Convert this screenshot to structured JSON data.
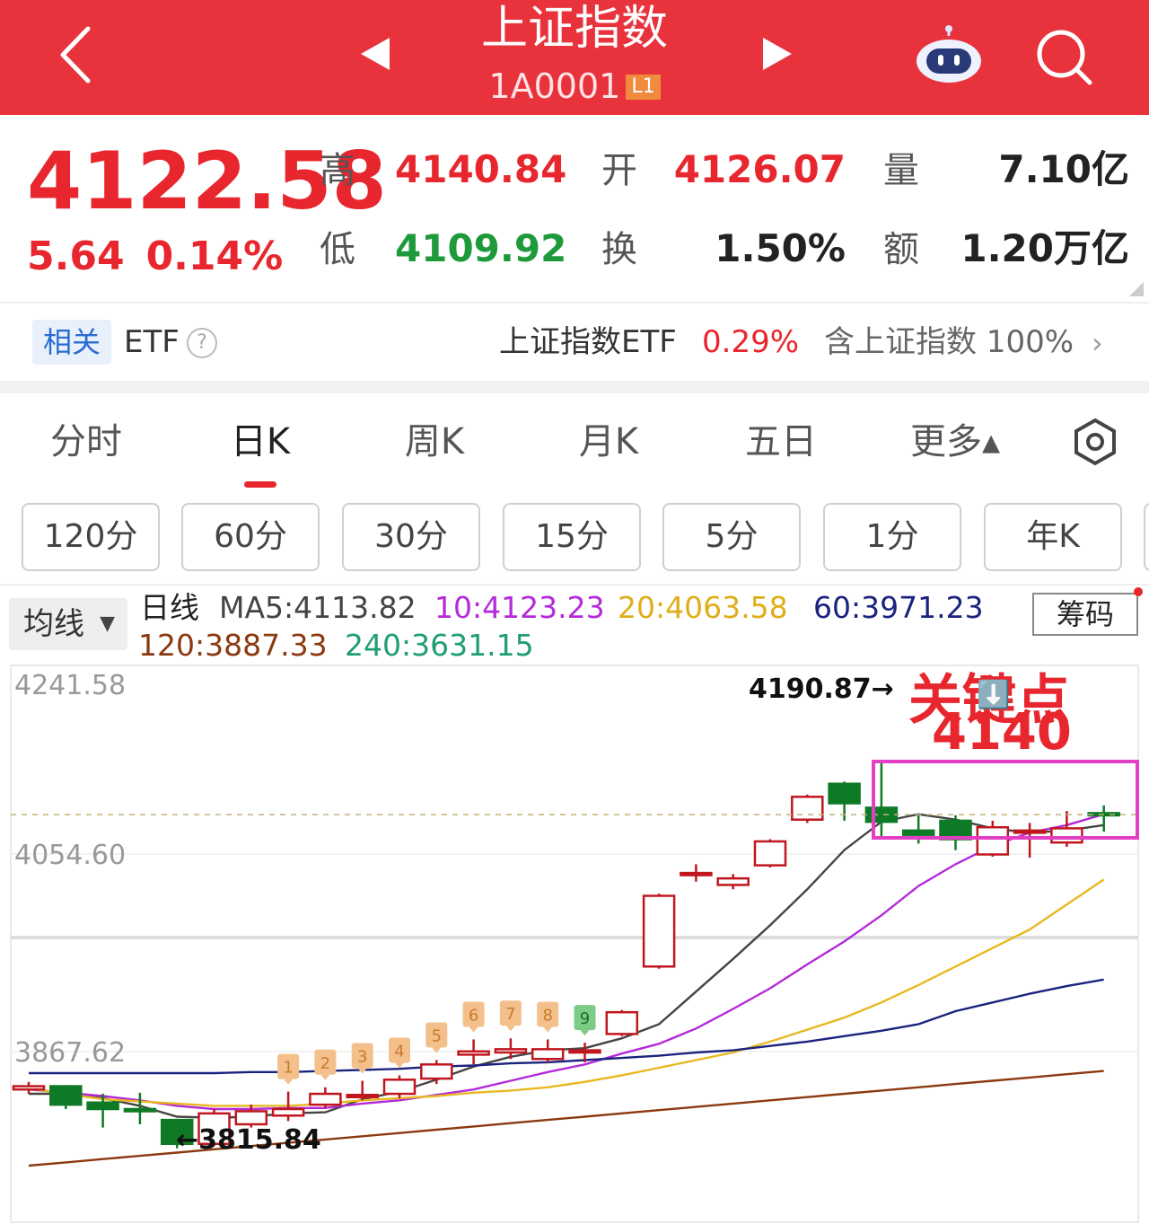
{
  "header": {
    "title": "上证指数",
    "code": "1A0001",
    "level_badge": "L1",
    "bg_color": "#e8323c"
  },
  "quote": {
    "price": "4122.58",
    "change": "5.64",
    "change_pct": "0.14%",
    "high_label": "高",
    "high": "4140.84",
    "low_label": "低",
    "low": "4109.92",
    "open_label": "开",
    "open": "4126.07",
    "turnover_label": "换",
    "turnover": "1.50%",
    "volume_label": "量",
    "volume": "7.10亿",
    "amount_label": "额",
    "amount": "1.20万亿"
  },
  "etf": {
    "tag": "相关",
    "label": "ETF",
    "help": "?",
    "name": "上证指数ETF",
    "pct": "0.29%",
    "include": "含上证指数 100%",
    "arrow": "›"
  },
  "tabs": [
    {
      "label": "分时"
    },
    {
      "label": "日K",
      "active": true
    },
    {
      "label": "周K"
    },
    {
      "label": "月K"
    },
    {
      "label": "五日"
    },
    {
      "label": "更多▴"
    }
  ],
  "periods": [
    "120分",
    "60分",
    "30分",
    "15分",
    "5分",
    "1分",
    "年K"
  ],
  "ma_legend": {
    "selector": "均线",
    "selector_caret": "▼",
    "period_label": "日线",
    "ma5": "MA5:4113.82",
    "ma10": "10:4123.23",
    "ma20": "20:4063.58",
    "ma60": "60:3971.23",
    "ma120": "120:3887.33",
    "ma240": "240:3631.15",
    "chip_button": "筹码",
    "colors": {
      "ma5": "#444444",
      "ma10": "#b42ad8",
      "ma20": "#e8b820",
      "ma60": "#1a237e",
      "ma120": "#8b3a10",
      "ma240": "#1f9e72"
    }
  },
  "chart_data": {
    "type": "candlestick",
    "y_ticks": [
      "4241.58",
      "4054.60",
      "3867.62"
    ],
    "ylim": [
      3800,
      4241.58
    ],
    "reference_price": 4122.58,
    "high_mark": "4190.87→",
    "low_mark": "←3815.84",
    "annotation_title": "关键点",
    "annotation_arrow": "⬇️",
    "annotation_value": "4140",
    "nine_labels": [
      "1",
      "2",
      "3",
      "4",
      "5",
      "6",
      "7",
      "8",
      "9"
    ],
    "candles": [
      {
        "o": 3870,
        "c": 3873,
        "h": 3877,
        "l": 3866
      },
      {
        "o": 3873,
        "c": 3856,
        "h": 3874,
        "l": 3852
      },
      {
        "o": 3858,
        "c": 3852,
        "h": 3866,
        "l": 3835
      },
      {
        "o": 3852,
        "c": 3851,
        "h": 3867,
        "l": 3838
      },
      {
        "o": 3842,
        "c": 3820,
        "h": 3843,
        "l": 3816
      },
      {
        "o": 3820,
        "c": 3848,
        "h": 3852,
        "l": 3818
      },
      {
        "o": 3838,
        "c": 3850,
        "h": 3856,
        "l": 3835
      },
      {
        "o": 3846,
        "c": 3852,
        "h": 3868,
        "l": 3841
      },
      {
        "o": 3856,
        "c": 3866,
        "h": 3872,
        "l": 3853
      },
      {
        "o": 3863,
        "c": 3865,
        "h": 3878,
        "l": 3860
      },
      {
        "o": 3866,
        "c": 3879,
        "h": 3883,
        "l": 3862
      },
      {
        "o": 3880,
        "c": 3893,
        "h": 3897,
        "l": 3875
      },
      {
        "o": 3902,
        "c": 3905,
        "h": 3916,
        "l": 3893
      },
      {
        "o": 3904,
        "c": 3907,
        "h": 3917,
        "l": 3898
      },
      {
        "o": 3898,
        "c": 3907,
        "h": 3916,
        "l": 3895
      },
      {
        "o": 3904,
        "c": 3906,
        "h": 3913,
        "l": 3895
      },
      {
        "o": 3921,
        "c": 3941,
        "h": 3943,
        "l": 3919
      },
      {
        "o": 3983,
        "c": 4048,
        "h": 4050,
        "l": 3981
      },
      {
        "o": 4067,
        "c": 4069,
        "h": 4077,
        "l": 4061
      },
      {
        "o": 4058,
        "c": 4064,
        "h": 4068,
        "l": 4054
      },
      {
        "o": 4076,
        "c": 4098,
        "h": 4100,
        "l": 4074
      },
      {
        "o": 4118,
        "c": 4139,
        "h": 4141,
        "l": 4115
      },
      {
        "o": 4151,
        "c": 4133,
        "h": 4153,
        "l": 4117
      },
      {
        "o": 4129,
        "c": 4116,
        "h": 4173,
        "l": 4101
      },
      {
        "o": 4108,
        "c": 4104,
        "h": 4123,
        "l": 4096
      },
      {
        "o": 4117,
        "c": 4100,
        "h": 4122,
        "l": 4090
      },
      {
        "o": 4086,
        "c": 4111,
        "h": 4117,
        "l": 4084
      },
      {
        "o": 4108,
        "c": 4108,
        "h": 4115,
        "l": 4083
      },
      {
        "o": 4097,
        "c": 4110,
        "h": 4126,
        "l": 4093
      },
      {
        "o": 4124,
        "c": 4122,
        "h": 4131,
        "l": 4107
      }
    ],
    "series": [
      {
        "name": "MA5",
        "color": "#444444",
        "values": [
          3866,
          3866,
          3862,
          3855,
          3845,
          3844,
          3845,
          3848,
          3849,
          3861,
          3868,
          3879,
          3891,
          3900,
          3906,
          3908,
          3917,
          3930,
          3960,
          3990,
          4021,
          4054,
          4090,
          4116,
          4123,
          4118,
          4110,
          4106,
          4108,
          4113
        ]
      },
      {
        "name": "MA10",
        "color": "#b42ad8",
        "values": [
          3870,
          3867,
          3864,
          3860,
          3855,
          3852,
          3852,
          3853,
          3853,
          3857,
          3860,
          3865,
          3870,
          3878,
          3886,
          3893,
          3903,
          3912,
          3926,
          3944,
          3963,
          3985,
          4006,
          4030,
          4057,
          4077,
          4094,
          4106,
          4113,
          4123
        ]
      },
      {
        "name": "MA20",
        "color": "#e8b820",
        "values": [
          3871,
          3866,
          3861,
          3859,
          3857,
          3855,
          3855,
          3855,
          3857,
          3860,
          3862,
          3864,
          3867,
          3869,
          3872,
          3877,
          3883,
          3890,
          3897,
          3904,
          3914,
          3925,
          3936,
          3950,
          3966,
          3983,
          4000,
          4017,
          4040,
          4063
        ]
      },
      {
        "name": "MA60",
        "color": "#1a237e",
        "values": [
          3885,
          3885,
          3885,
          3885,
          3885,
          3885,
          3886,
          3886,
          3887,
          3888,
          3889,
          3891,
          3892,
          3894,
          3895,
          3897,
          3899,
          3901,
          3904,
          3906,
          3910,
          3914,
          3919,
          3924,
          3930,
          3942,
          3950,
          3958,
          3965,
          3971
        ]
      },
      {
        "name": "MA120",
        "color": "#8b3a10",
        "values": [
          3800,
          3803,
          3806,
          3809,
          3812,
          3815,
          3818,
          3821,
          3824,
          3827,
          3830,
          3833,
          3836,
          3839,
          3842,
          3845,
          3848,
          3851,
          3854,
          3857,
          3860,
          3863,
          3866,
          3869,
          3872,
          3875,
          3878,
          3881,
          3884,
          3887
        ]
      }
    ],
    "colors": {
      "up": "#c0171f",
      "down": "#0f7a26",
      "annotation": "#e8262e",
      "box": "#e23fc4",
      "nine_orange": "#f3c08c",
      "nine_green": "#7bcc87"
    }
  }
}
